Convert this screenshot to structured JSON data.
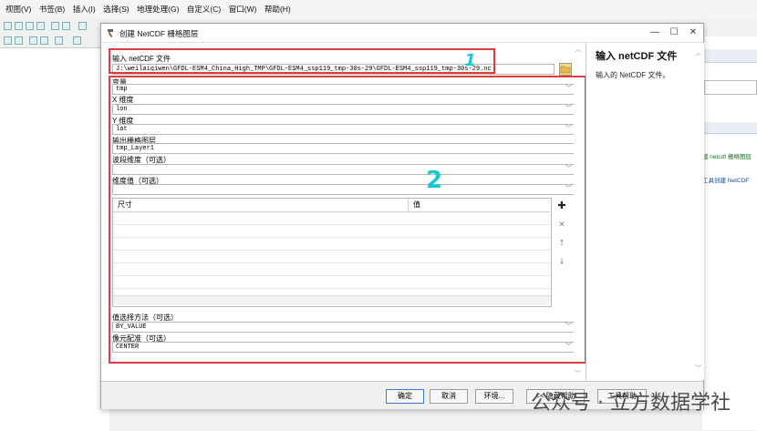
{
  "menubar": {
    "items": [
      "视图(V)",
      "书签(B)",
      "插入(I)",
      "选择(S)",
      "地理处理(G)",
      "自定义(C)",
      "窗口(W)",
      "帮助(H)"
    ]
  },
  "background": {
    "right_panel": {
      "line1": "建 netcdf 栅格图层",
      "line2": "工具创建 NetCDF"
    },
    "watermark": "公众号 · 立方数据学社"
  },
  "dialog": {
    "title": "创建 NetCDF 栅格图层",
    "window_controls": {
      "minimize": "—",
      "maximize": "☐",
      "close": "✕"
    },
    "annotations": {
      "one": "1",
      "two": "2"
    },
    "fields": {
      "input_file": {
        "label": "输入 netCDF 文件",
        "value": "J:\\weilaiqiwen\\GFDL-ESM4_China_High_TMP\\GFDL-ESM4_ssp119_tmp-30s-29\\GFDL-ESM4_ssp119_tmp-30s-29.nc"
      },
      "variable": {
        "label": "变量",
        "value": "tmp"
      },
      "x_dim": {
        "label": "X 维度",
        "value": "lon"
      },
      "y_dim": {
        "label": "Y 维度",
        "value": "lat"
      },
      "output_layer": {
        "label": "输出栅格图层",
        "value": "tmp_Layer1"
      },
      "band_dim": {
        "label": "波段维度（可选）",
        "value": ""
      },
      "dim_values": {
        "label": "维度值（可选）",
        "value": ""
      },
      "value_select_method": {
        "label": "值选择方法（可选）",
        "value": "BY_VALUE"
      },
      "cell_registration": {
        "label": "像元配准（可选）",
        "value": "CENTER"
      }
    },
    "table": {
      "col_size": "尺寸",
      "col_value": "值"
    },
    "table_buttons": {
      "add": "✚",
      "remove": "✕",
      "up": "↑",
      "down": "↓"
    },
    "buttons": {
      "ok": "确定",
      "cancel": "取消",
      "env": "环境...",
      "hide_help": "<< 隐藏帮助",
      "tool_help": "工具帮助"
    },
    "help": {
      "title": "输入 netCDF 文件",
      "desc": "输入的 NetCDF 文件。"
    }
  },
  "colors": {
    "annotation_red": "#e23b3b",
    "annotation_cyan": "#19c7d4"
  }
}
